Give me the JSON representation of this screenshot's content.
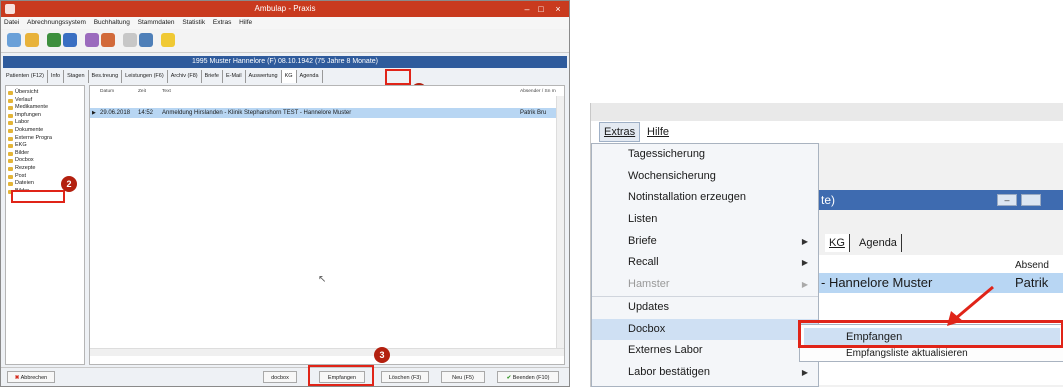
{
  "left_window": {
    "title": "Ambulap - Praxis",
    "menu": [
      "Datei",
      "Abrechnungssystem",
      "Buchhaltung",
      "Stammdaten",
      "Statistik",
      "Extras",
      "Hilfe"
    ],
    "patient_title": "1995  Muster Hannelore (F) 08.10.1942 (75 Jahre 8 Monate)",
    "tabs": [
      "Patienten (F12)",
      "Info",
      "Stagen",
      "Bes.treung",
      "Leistungen (F6)",
      "Archiv (F8)",
      "Briefe",
      "E-Mail",
      "Auswertung",
      "KG",
      "Agenda"
    ],
    "tree": [
      "Übersicht",
      "Verlauf",
      "Medikamente",
      "Impfungen",
      "Labor",
      "Dokumente",
      "Externe Progra",
      "EKG",
      "Bilder",
      "Docbox",
      "Rezepte",
      "Post",
      "Dateien",
      "Bilder"
    ],
    "columns": {
      "datum": "Datum",
      "zeit": "Zeit",
      "text": "Text",
      "absender": "Absender / Sn m"
    },
    "row": {
      "datum": "29.06.2018",
      "zeit": "14:52",
      "text": "Anmeldung Hirslanden - Klinik Stephanshorn TEST - Hannelore Muster",
      "absender": "Patrik Bru"
    },
    "buttons": {
      "abbrechen": "Abbrechen",
      "docbox": "docbox",
      "empfangen": "Empfangen",
      "loeschen": "Löschen (F3)",
      "neu": "Neu (F5)",
      "beenden": "Beenden (F10)"
    },
    "badges": [
      "1",
      "2",
      "3"
    ]
  },
  "right_window": {
    "menu": [
      "Extras",
      "Hilfe"
    ],
    "items": [
      {
        "label": "Tagessicherung",
        "arrow": false,
        "disabled": false
      },
      {
        "label": "Wochensicherung",
        "arrow": false,
        "disabled": false
      },
      {
        "label": "Notinstallation erzeugen",
        "arrow": false,
        "disabled": false
      },
      {
        "label": "Listen",
        "arrow": false,
        "disabled": false
      },
      {
        "label": "Briefe",
        "arrow": true,
        "disabled": false
      },
      {
        "label": "Recall",
        "arrow": true,
        "disabled": false
      },
      {
        "label": "Hamster",
        "arrow": true,
        "disabled": true
      },
      {
        "label": "Updates",
        "arrow": false,
        "disabled": false
      },
      {
        "label": "Docbox",
        "arrow": true,
        "disabled": false
      },
      {
        "label": "Externes Labor",
        "arrow": false,
        "disabled": false
      },
      {
        "label": "Labor bestätigen",
        "arrow": true,
        "disabled": false
      }
    ],
    "bg_title_fragment": "te)",
    "bg_tabs": [
      "KG",
      "Agenda"
    ],
    "bg_column": "Absend",
    "bg_row_name": "- Hannelore Muster",
    "bg_row_sender": "Patrik",
    "submenu": [
      "Empfangen",
      "Empfangsliste aktualisieren"
    ]
  },
  "colors": {
    "accent_red": "#e02418",
    "selection_blue": "#b8d6f3",
    "title_blue": "#2f5b9c"
  }
}
